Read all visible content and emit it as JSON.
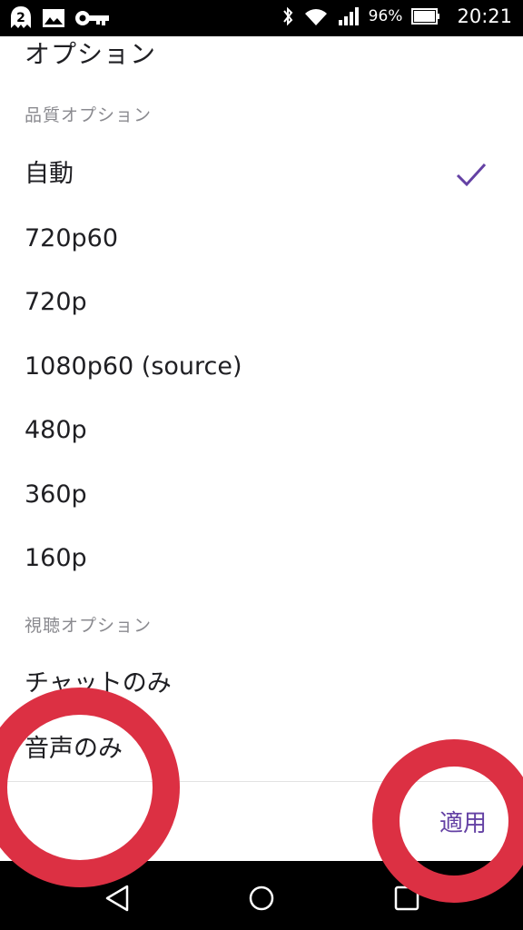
{
  "status_bar": {
    "battery_percent": "96%",
    "time": "20:21",
    "icons": [
      "notification-2-icon",
      "image-icon",
      "key-icon",
      "bluetooth-icon",
      "wifi-icon",
      "signal-icon",
      "battery-icon"
    ]
  },
  "dialog": {
    "title": "オプション",
    "quality_section": {
      "header": "品質オプション",
      "options": [
        {
          "label": "自動",
          "selected": true
        },
        {
          "label": "720p60",
          "selected": false
        },
        {
          "label": "720p",
          "selected": false
        },
        {
          "label": "1080p60 (source)",
          "selected": false
        },
        {
          "label": "480p",
          "selected": false
        },
        {
          "label": "360p",
          "selected": false
        },
        {
          "label": "160p",
          "selected": false
        }
      ]
    },
    "viewing_section": {
      "header": "視聴オプション",
      "options": [
        {
          "label": "チャットのみ"
        },
        {
          "label": "音声のみ"
        }
      ]
    },
    "apply_label": "適用"
  },
  "nav_bar": {
    "buttons": [
      "back-icon",
      "home-icon",
      "recents-icon"
    ]
  },
  "colors": {
    "accent": "#6441a4",
    "annotation_ring": "#dc3043",
    "text": "#1f1f23",
    "section_header": "#8a8a8f"
  }
}
